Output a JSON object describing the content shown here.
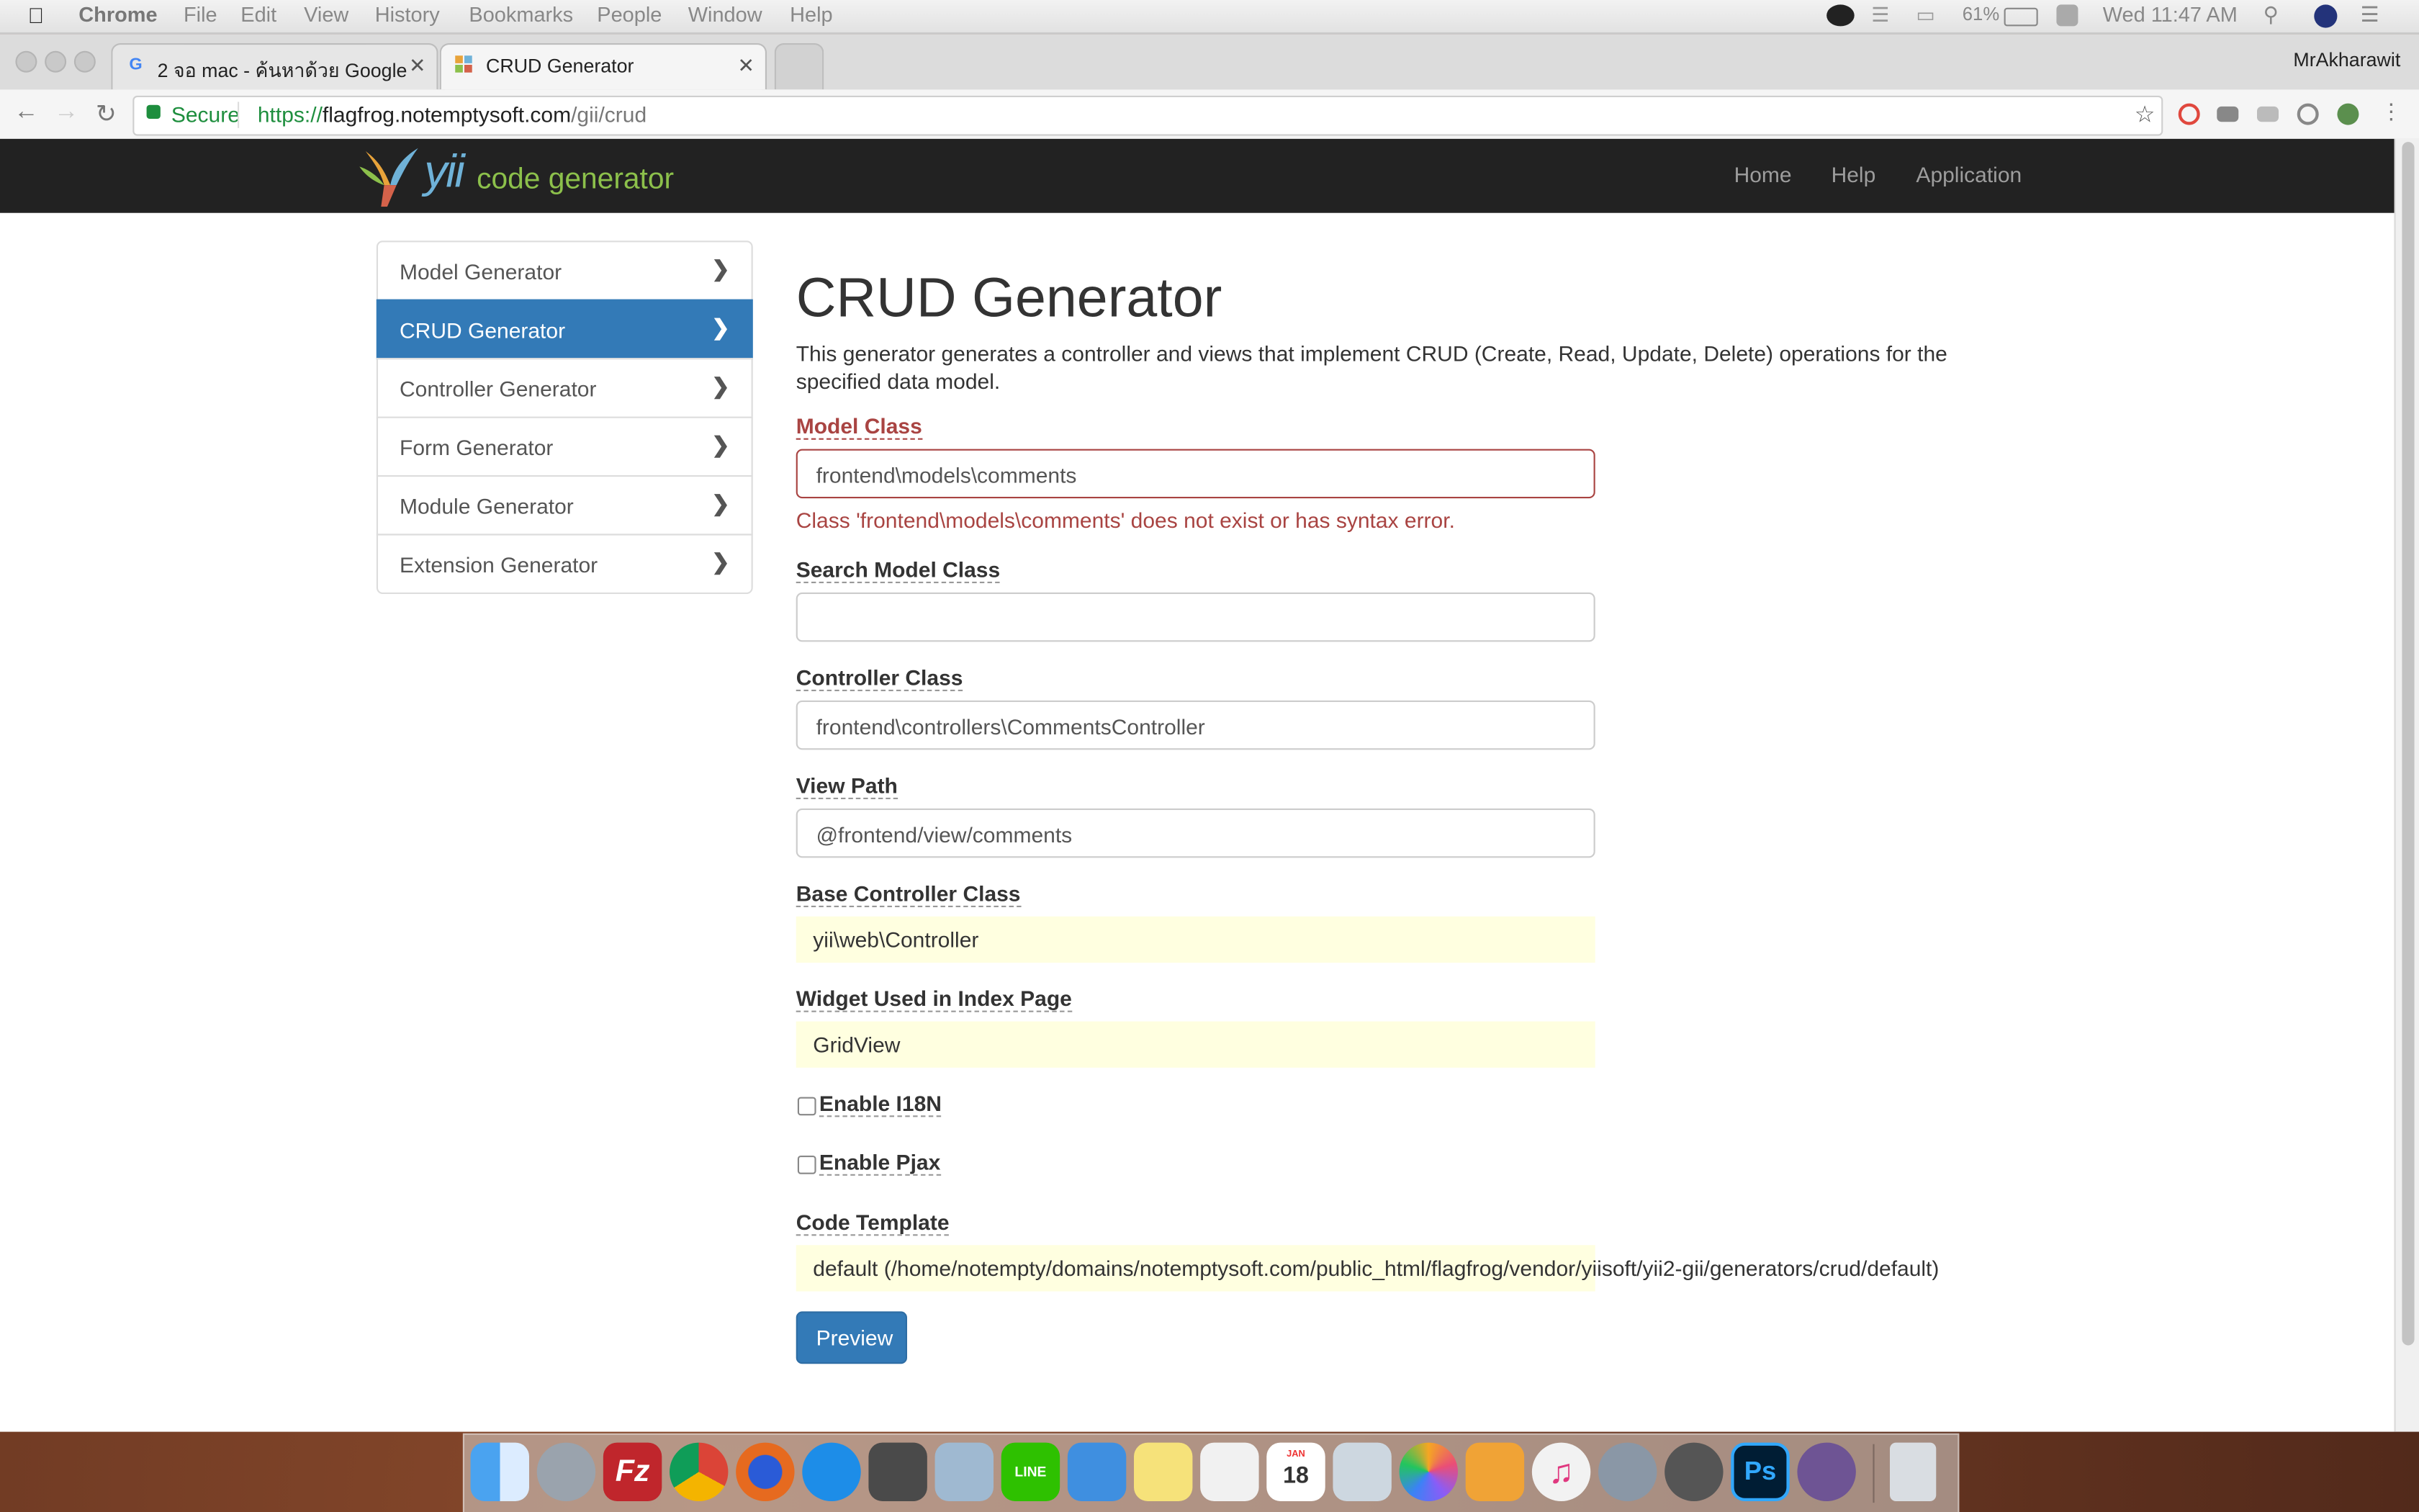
{
  "menubar": {
    "app": "Chrome",
    "items": [
      "File",
      "Edit",
      "View",
      "History",
      "Bookmarks",
      "People",
      "Window",
      "Help"
    ],
    "battery": "61%",
    "clock": "Wed 11:47 AM"
  },
  "browser": {
    "tabs": [
      {
        "label": "2 จอ mac - ค้นหาด้วย Google",
        "favicon": "G"
      },
      {
        "label": "CRUD Generator",
        "favicon": "yii"
      }
    ],
    "profile": "MrAkharawit",
    "secure_label": "Secure",
    "url": {
      "scheme": "https://",
      "host": "flagfrog.notemptysoft.com",
      "path": "/gii/crud"
    }
  },
  "navbar": {
    "logo_yii": "yii",
    "logo_text": "code generator",
    "links": [
      "Home",
      "Help",
      "Application"
    ]
  },
  "sidebar": {
    "items": [
      {
        "label": "Model Generator",
        "active": false
      },
      {
        "label": "CRUD Generator",
        "active": true
      },
      {
        "label": "Controller Generator",
        "active": false
      },
      {
        "label": "Form Generator",
        "active": false
      },
      {
        "label": "Module Generator",
        "active": false
      },
      {
        "label": "Extension Generator",
        "active": false
      }
    ]
  },
  "main": {
    "title": "CRUD Generator",
    "description": "This generator generates a controller and views that implement CRUD (Create, Read, Update, Delete) operations for the specified data model.",
    "model_class": {
      "label": "Model Class",
      "value": "frontend\\models\\comments",
      "error": "Class 'frontend\\models\\comments' does not exist or has syntax error."
    },
    "search_model_class": {
      "label": "Search Model Class",
      "value": ""
    },
    "controller_class": {
      "label": "Controller Class",
      "value": "frontend\\controllers\\CommentsController"
    },
    "view_path": {
      "label": "View Path",
      "value": "@frontend/view/comments"
    },
    "base_controller_class": {
      "label": "Base Controller Class",
      "value": "yii\\web\\Controller"
    },
    "index_widget": {
      "label": "Widget Used in Index Page",
      "value": "GridView"
    },
    "enable_i18n": {
      "label": "Enable I18N",
      "checked": false
    },
    "enable_pjax": {
      "label": "Enable Pjax",
      "checked": false
    },
    "code_template": {
      "label": "Code Template",
      "value": "default (/home/notempty/domains/notemptysoft.com/public_html/flagfrog/vendor/yiisoft/yii2-gii/generators/crud/default)"
    },
    "preview_button": "Preview"
  },
  "dock": {
    "apps": [
      "finder",
      "launchpad",
      "filezilla",
      "chrome",
      "firefox",
      "safari",
      "sublime-text",
      "preview",
      "line",
      "xcode",
      "notes",
      "textedit",
      "calendar",
      "image-capture",
      "photos",
      "pages",
      "itunes",
      "system-preferences",
      "settings",
      "photoshop",
      "github-desktop",
      "trash"
    ],
    "filezilla_label": "Fz",
    "line_label": "LINE",
    "calendar_month": "JAN",
    "calendar_day": "18",
    "photoshop_label": "Ps"
  },
  "colors": {
    "accent": "#337ab7",
    "error": "#a94442",
    "navbar": "#222222",
    "sticky": "#ffffe0"
  }
}
